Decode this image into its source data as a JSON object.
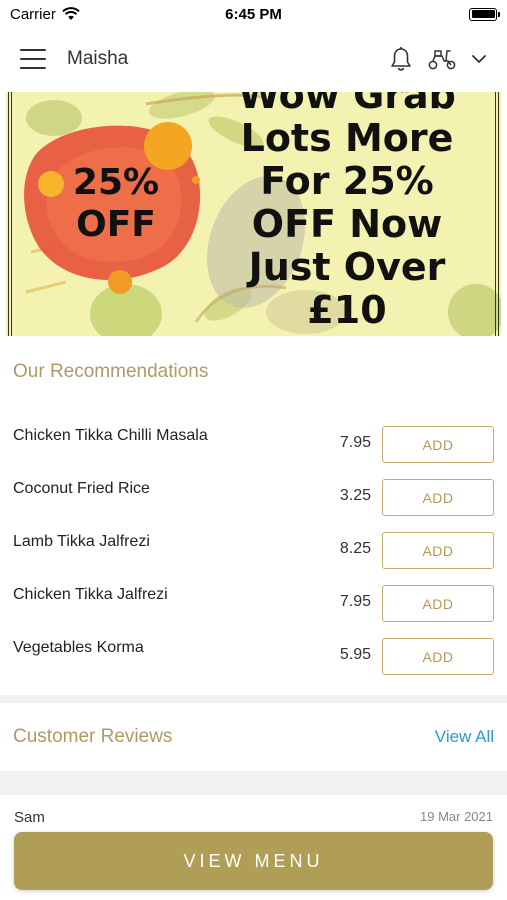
{
  "status": {
    "carrier": "Carrier",
    "time": "6:45 PM"
  },
  "header": {
    "title": "Maisha",
    "icons": [
      "menu-icon",
      "bell-icon",
      "scooter-icon",
      "chevron-down-icon"
    ]
  },
  "banner": {
    "badge": "25% OFF",
    "lines": [
      "Wow Grab",
      "Lots More",
      "For 25%",
      "OFF Now",
      "Just Over",
      "£10"
    ]
  },
  "recommendations": {
    "title": "Our Recommendations",
    "items": [
      {
        "name": "Chicken Tikka Chilli Masala",
        "price": "7.95",
        "button": "ADD"
      },
      {
        "name": "Coconut Fried Rice",
        "price": "3.25",
        "button": "ADD"
      },
      {
        "name": "Lamb Tikka Jalfrezi",
        "price": "8.25",
        "button": "ADD"
      },
      {
        "name": "Chicken Tikka Jalfrezi",
        "price": "7.95",
        "button": "ADD"
      },
      {
        "name": "Vegetables Korma",
        "price": "5.95",
        "button": "ADD"
      }
    ]
  },
  "reviews": {
    "title": "Customer Reviews",
    "view_all": "View All",
    "items": [
      {
        "name": "Sam",
        "date": "19 Mar 2021"
      }
    ]
  },
  "footer": {
    "button": "VIEW MENU"
  },
  "colors": {
    "accent": "#b09e57",
    "link": "#2a9bd0",
    "banner_bg": "#f3f2b0",
    "badge": "#e8553c"
  }
}
